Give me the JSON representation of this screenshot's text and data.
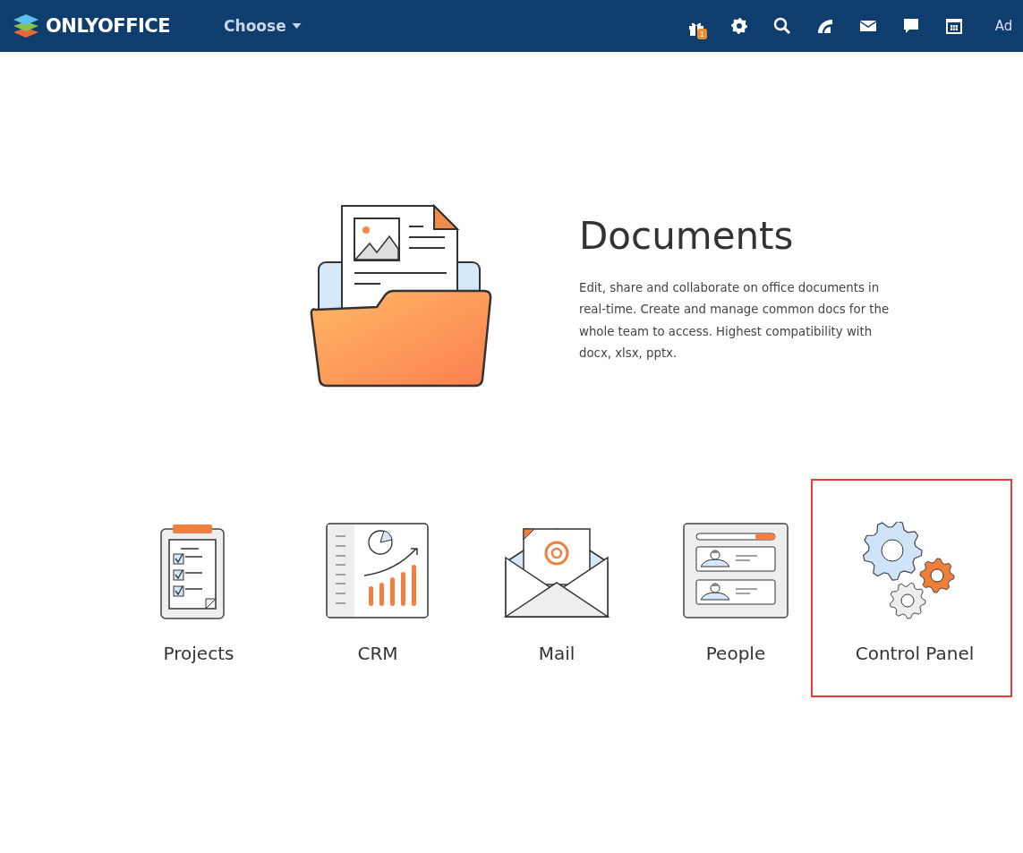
{
  "header": {
    "brand": "ONLYOFFICE",
    "menu": "Choose",
    "notifications_badge": "1",
    "user": "Ad"
  },
  "hero": {
    "title": "Documents",
    "description": "Edit, share and collaborate on office documents in real-time. Create and manage common docs for the whole team to access. Highest compatibility with docx, xlsx, pptx."
  },
  "modules": [
    {
      "kind": "projects",
      "label": "Projects",
      "highlighted": false
    },
    {
      "kind": "crm",
      "label": "CRM",
      "highlighted": false
    },
    {
      "kind": "mail",
      "label": "Mail",
      "highlighted": false
    },
    {
      "kind": "people",
      "label": "People",
      "highlighted": false
    },
    {
      "kind": "control",
      "label": "Control Panel",
      "highlighted": true
    }
  ]
}
